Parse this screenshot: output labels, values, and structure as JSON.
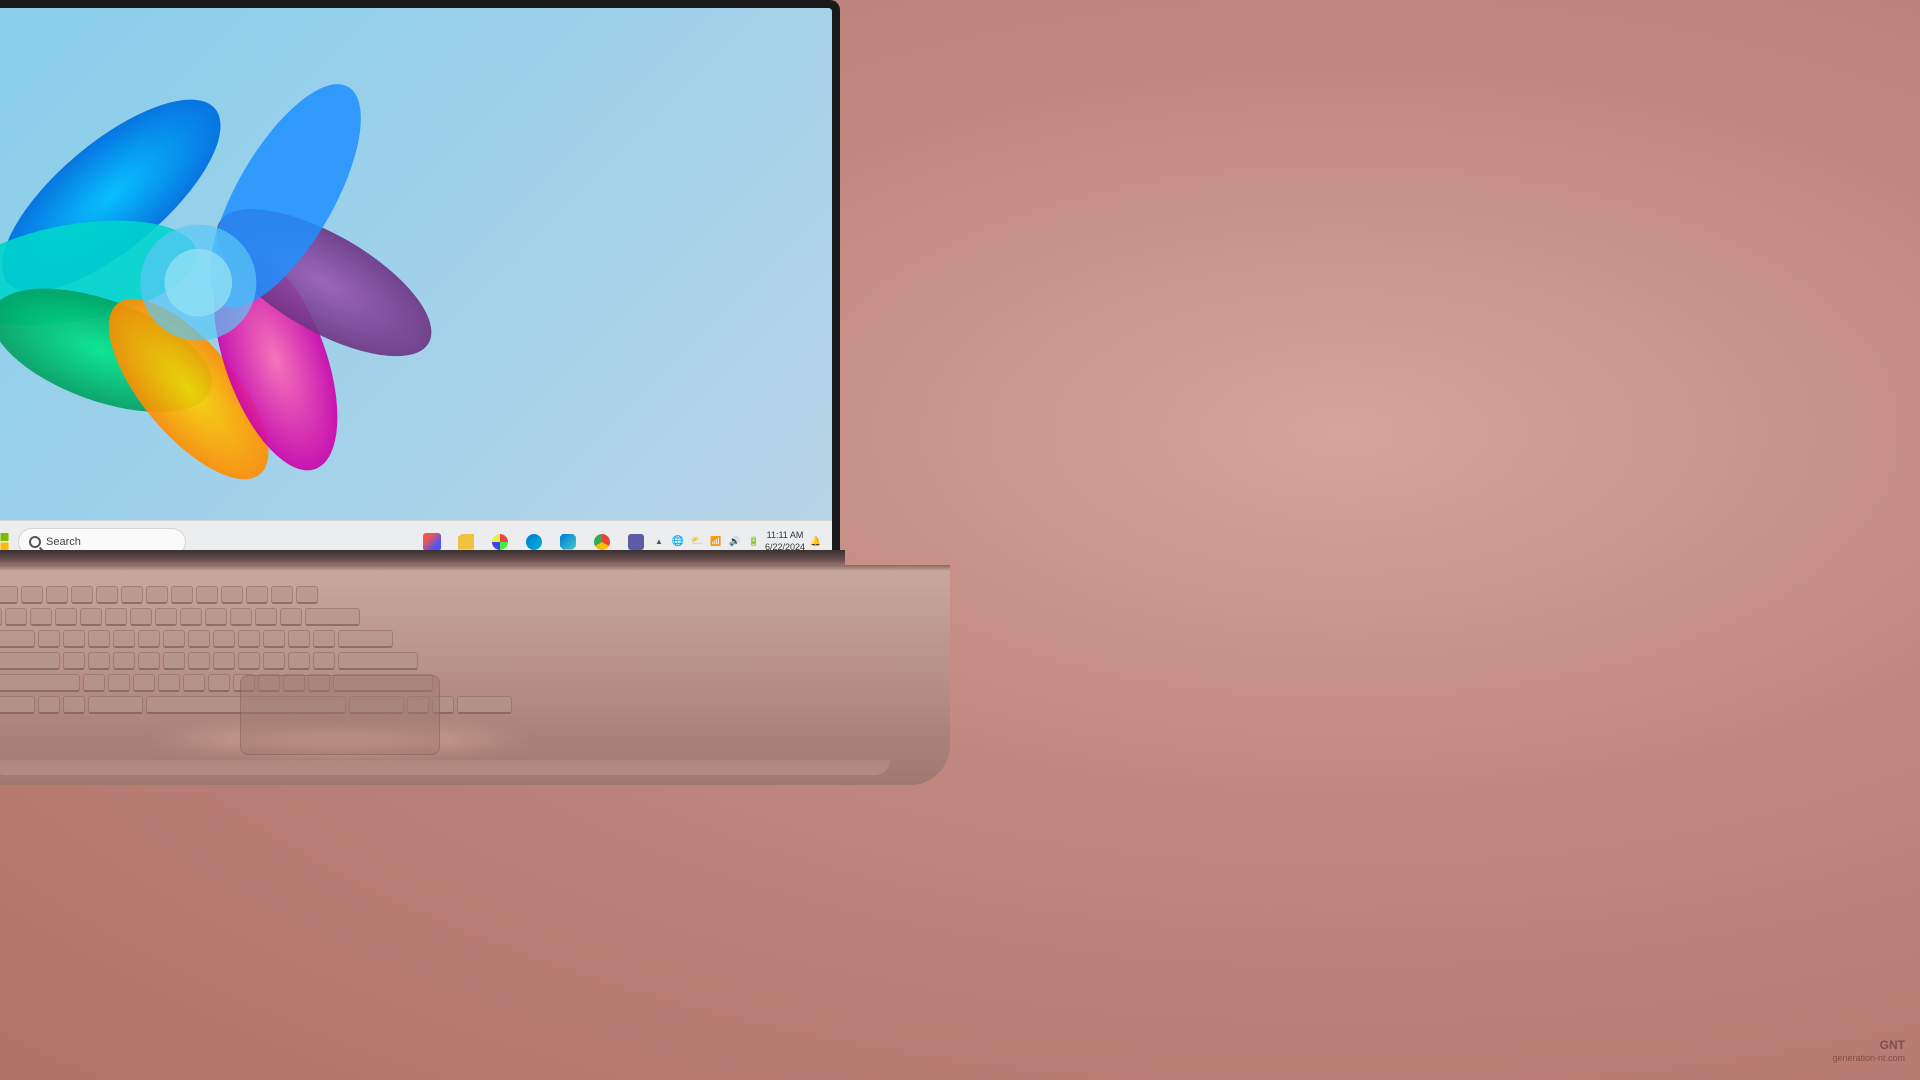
{
  "background": {
    "color": "#c9948a"
  },
  "taskbar": {
    "search_placeholder": "Search",
    "clock": {
      "time": "11:11 AM",
      "date": "6/22/2024"
    },
    "apps": [
      {
        "name": "Paint",
        "icon": "paint-icon"
      },
      {
        "name": "File Explorer",
        "icon": "files-icon"
      },
      {
        "name": "Photos",
        "icon": "photos-icon"
      },
      {
        "name": "Edge",
        "icon": "edge-icon"
      },
      {
        "name": "Microsoft Store",
        "icon": "store-icon"
      },
      {
        "name": "Chrome",
        "icon": "chrome-icon"
      },
      {
        "name": "Teams",
        "icon": "teams-icon"
      }
    ]
  },
  "watermark": {
    "line1": "GNT",
    "line2": "generation-nt.com"
  }
}
